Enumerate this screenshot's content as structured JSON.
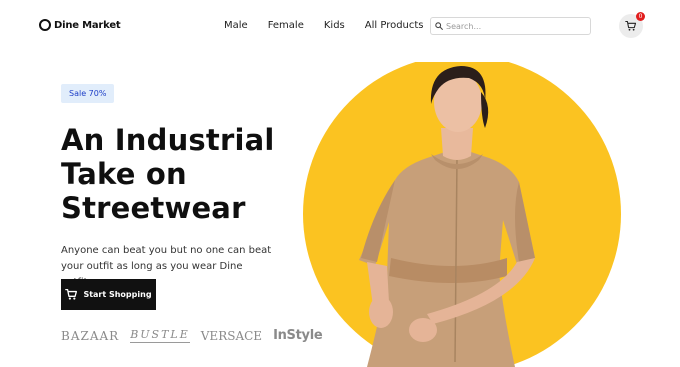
{
  "nav": {
    "logo_text": "Dine Market",
    "links": [
      "Male",
      "Female",
      "Kids",
      "All Products"
    ],
    "search_placeholder": "Search...",
    "cart_count": "0"
  },
  "hero": {
    "badge": "Sale 70%",
    "headline_lines": [
      "An Industrial",
      "Take on",
      "Streetwear"
    ],
    "subtext": "Anyone can beat you but no one can beat your outfit as long as you wear Dine outfits.",
    "cta_label": "Start Shopping"
  },
  "brands": [
    "BAZAAR",
    "BUSTLE",
    "VERSACE",
    "InStyle"
  ],
  "colors": {
    "accent_yellow": "#fbc321",
    "badge_bg": "#e1edfb",
    "badge_text": "#1d3ec7",
    "cta_bg": "#111111",
    "cart_badge": "#e11d1d"
  },
  "icons": {
    "logo": "ring-logo-icon",
    "search": "search-icon",
    "cart": "shopping-cart-icon",
    "cta": "shopping-cart-icon"
  }
}
